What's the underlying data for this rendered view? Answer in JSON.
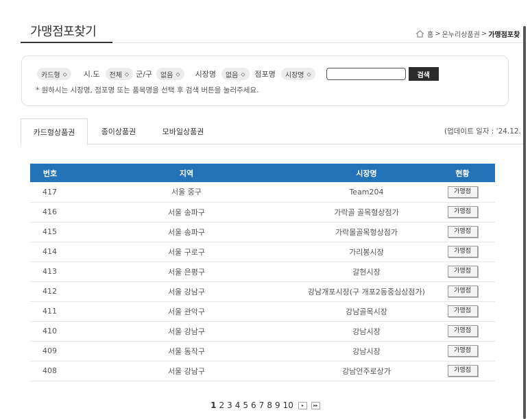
{
  "page": {
    "title": "가맹점포찾기"
  },
  "breadcrumb": {
    "home": "홈",
    "sep": ">",
    "parent": "온누리상품권",
    "current": "가맹점포찾"
  },
  "filters": {
    "card_type": "카드형",
    "sido_label": "시.도",
    "sido_value": "전체",
    "gungu_label": "군/구",
    "gungu_value": "없음",
    "market_label": "시장명",
    "market_value": "없음",
    "store_label": "점포명",
    "store_value": "시장명",
    "search_value": "",
    "search_button": "검색",
    "hint": "* 원하시는 시장명, 점포명 또는 품목명을 선택 후 검색 버튼을 눌러주세요."
  },
  "tabs": [
    {
      "label": "카드형상품권"
    },
    {
      "label": "종이상품권"
    },
    {
      "label": "모바일상품권"
    }
  ],
  "update_text": "(업데이트 일자 : '24.12.",
  "table": {
    "headers": [
      "번호",
      "지역",
      "시장명",
      "현황"
    ],
    "rows": [
      {
        "no": "417",
        "region": "서울 중구",
        "market": "Team204",
        "status": "가맹점"
      },
      {
        "no": "416",
        "region": "서울 송파구",
        "market": "가락골 골목형상점가",
        "status": "가맹점"
      },
      {
        "no": "415",
        "region": "서울 송파구",
        "market": "가락몰골목형상점가",
        "status": "가맹점"
      },
      {
        "no": "414",
        "region": "서울 구로구",
        "market": "가리봉시장",
        "status": "가맹점"
      },
      {
        "no": "413",
        "region": "서울 은평구",
        "market": "갈현시장",
        "status": "가맹점"
      },
      {
        "no": "412",
        "region": "서울 강남구",
        "market": "강남개포시장(구 개포2동중심상점가)",
        "status": "가맹점"
      },
      {
        "no": "411",
        "region": "서울 관악구",
        "market": "강남골목시장",
        "status": "가맹점"
      },
      {
        "no": "410",
        "region": "서울 강남구",
        "market": "강남시장",
        "status": "가맹점"
      },
      {
        "no": "409",
        "region": "서울 동작구",
        "market": "강남시장",
        "status": "가맹점"
      },
      {
        "no": "408",
        "region": "서울 강남구",
        "market": "강남언주로상가",
        "status": "가맹점"
      }
    ]
  },
  "pagination": {
    "pages": [
      "1",
      "2",
      "3",
      "4",
      "5",
      "6",
      "7",
      "8",
      "9",
      "10"
    ],
    "current": "1",
    "next": "▸",
    "last": "▸▸"
  },
  "colors": {
    "header_blue": "#2472b8",
    "search_btn": "#2b2b2b"
  }
}
